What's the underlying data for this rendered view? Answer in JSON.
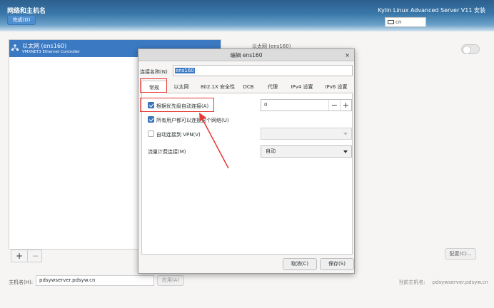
{
  "header": {
    "title": "网络和主机名",
    "done_label": "完成(D)",
    "product": "Kylin Linux Advanced Server V11 安装",
    "keyboard": "cn"
  },
  "connections": [
    {
      "name": "以太网 (ens160)",
      "description": "VMXNET3 Ethernet Controller"
    }
  ],
  "list_buttons": {
    "add": "+",
    "remove": "−"
  },
  "right": {
    "title_partial": "以太网 (ens160)",
    "configure_label": "配置(C)..."
  },
  "bottom": {
    "hostname_label": "主机名(H):",
    "hostname_value": "pdsywserver.pdsyw.cn",
    "apply_label": "应用(A)",
    "current_label": "当前主机名:",
    "current_value": "pdsywserver.pdsyw.cn"
  },
  "dialog": {
    "title": "编辑 ens160",
    "close": "×",
    "conn_name_label": "连接名称(N)",
    "conn_name_value": "ens160",
    "tabs": [
      "常规",
      "以太网",
      "802.1X 安全性",
      "DCB",
      "代理",
      "IPv4 设置",
      "IPv6 设置"
    ],
    "active_tab": "常规",
    "auto_connect_label": "根据优先级自动连接(A)",
    "auto_connect_checked": true,
    "priority_value": "0",
    "spin_minus": "−",
    "spin_plus": "+",
    "all_users_label": "所有用户都可以连接这个网络(U)",
    "all_users_checked": true,
    "vpn_label": "自动连接到 VPN(V)",
    "vpn_checked": false,
    "metered_label": "流量计费连接(M)",
    "metered_value": "自动",
    "cancel_label": "取消(C)",
    "save_label": "保存(S)"
  },
  "colors": {
    "accent": "#3b79c2",
    "annotation": "#e53935"
  }
}
